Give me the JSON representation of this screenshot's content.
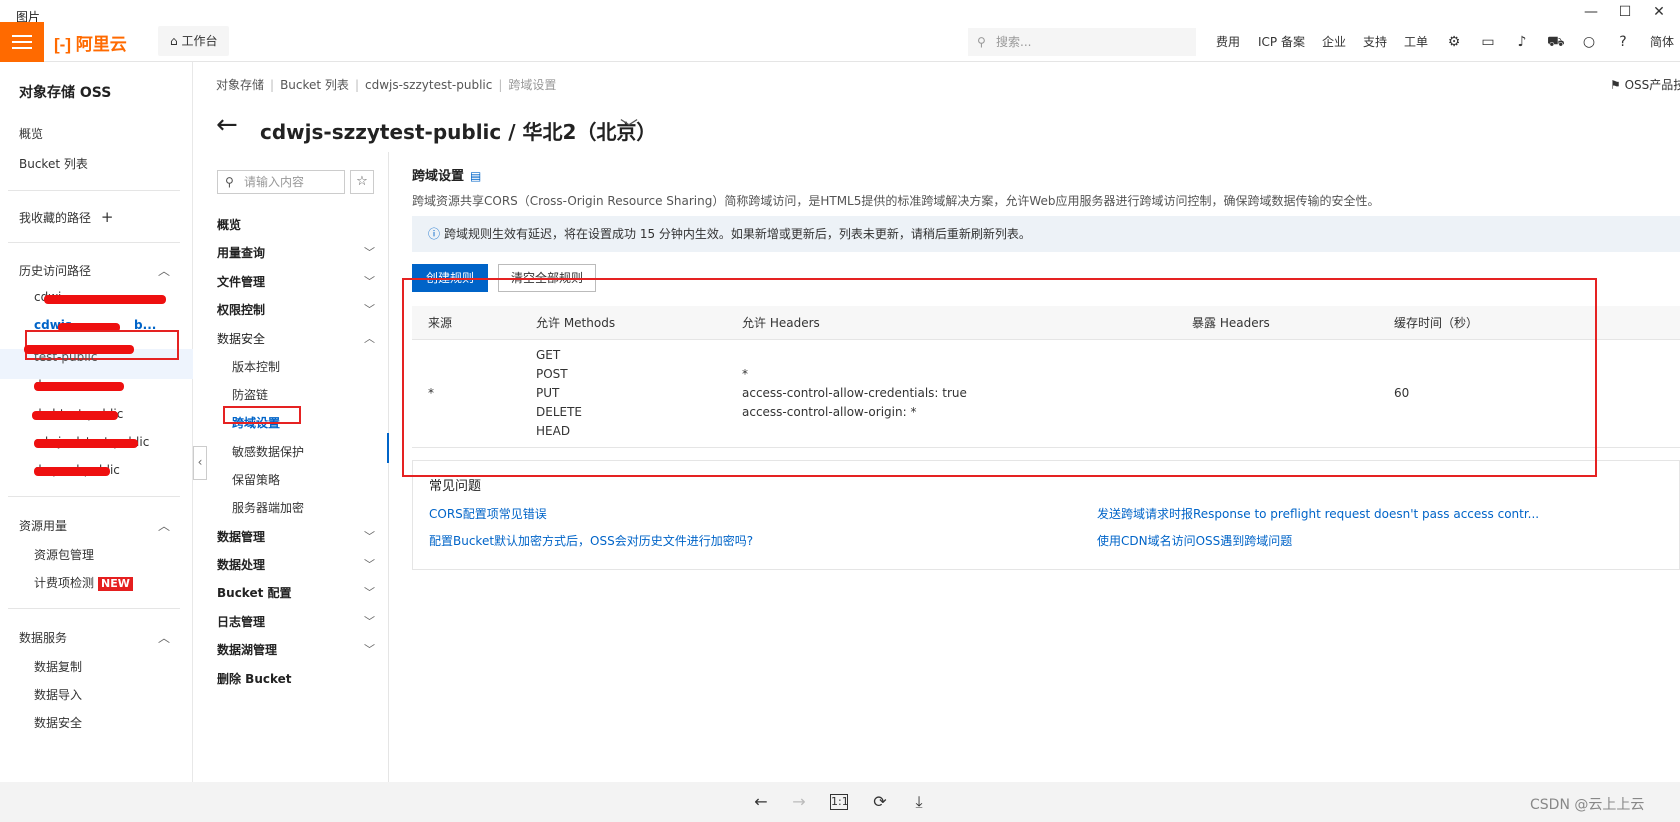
{
  "viewer": {
    "title": "图片",
    "minimize": "—",
    "maximize": "☐",
    "close": "✕"
  },
  "topbar": {
    "logo": "[-] 阿里云",
    "workbench": "工作台",
    "search_placeholder": "搜索...",
    "nav": [
      "费用",
      "ICP 备案",
      "企业",
      "支持",
      "工单"
    ],
    "lang": "简体"
  },
  "sidebar": {
    "title": "对象存储 OSS",
    "overview": "概览",
    "bucket_list": "Bucket 列表",
    "favorites": "我收藏的路径",
    "history": "历史访问路径",
    "history_items": [
      "cdwj",
      "cdwjs",
      "test-public",
      "ds",
      "dsd-test-public",
      "cdwjs-dstest-public",
      "ds-prod-public"
    ],
    "history_active_suffix": "b...",
    "resource_usage": "资源用量",
    "resource_items": [
      "资源包管理",
      "计费项检测"
    ],
    "new_badge": "NEW",
    "data_service": "数据服务",
    "data_items": [
      "数据复制",
      "数据导入",
      "数据安全"
    ]
  },
  "breadcrumb": [
    "对象存储",
    "Bucket 列表",
    "cdwjs-szzytest-public",
    "跨域设置"
  ],
  "oss_doc": "OSS产品技术",
  "page_title": "cdwjs-szzytest-public / 华北2（北京）",
  "subnav": {
    "search_placeholder": "请输入内容",
    "items": {
      "overview": "概览",
      "usage": "用量查询",
      "files": "文件管理",
      "access": "权限控制",
      "security": "数据安全",
      "versioning": "版本控制",
      "hotlink": "防盗链",
      "cors": "跨域设置",
      "sensitive": "敏感数据保护",
      "retention": "保留策略",
      "encryption": "服务器端加密",
      "data_mgmt": "数据管理",
      "data_proc": "数据处理",
      "bucket_config": "Bucket 配置",
      "logs": "日志管理",
      "datalake": "数据湖管理",
      "delete": "删除 Bucket"
    }
  },
  "content": {
    "title": "跨域设置",
    "desc": "跨域资源共享CORS（Cross-Origin Resource Sharing）简称跨域访问，是HTML5提供的标准跨域解决方案，允许Web应用服务器进行跨域访问控制，确保跨域数据传输的安全性。",
    "notice": "跨域规则生效有延迟，将在设置成功 15 分钟内生效。如果新增或更新后，列表未更新，请稍后重新刷新列表。",
    "create_btn": "创建规则",
    "clear_btn": "清空全部规则",
    "table": {
      "headers": [
        "来源",
        "允许 Methods",
        "允许 Headers",
        "暴露 Headers",
        "缓存时间（秒）"
      ],
      "row": {
        "origin": "*",
        "methods": [
          "GET",
          "POST",
          "PUT",
          "DELETE",
          "HEAD"
        ],
        "headers": [
          "*",
          "access-control-allow-credentials: true",
          "access-control-allow-origin: *"
        ],
        "expose": "",
        "cache": "60"
      }
    },
    "faq": {
      "title": "常见问题",
      "links": [
        "CORS配置项常见错误",
        "发送跨域请求时报Response to preflight request doesn't pass access contr...",
        "配置Bucket默认加密方式后，OSS会对历史文件进行加密吗?",
        "使用CDN域名访问OSS遇到跨域问题"
      ]
    }
  },
  "bottom": {
    "ratio": "1:1",
    "watermark": "CSDN @云上上云"
  },
  "colors": {
    "brand": "#ff6a00",
    "primary": "#0064c8",
    "annotation": "#e52222"
  }
}
